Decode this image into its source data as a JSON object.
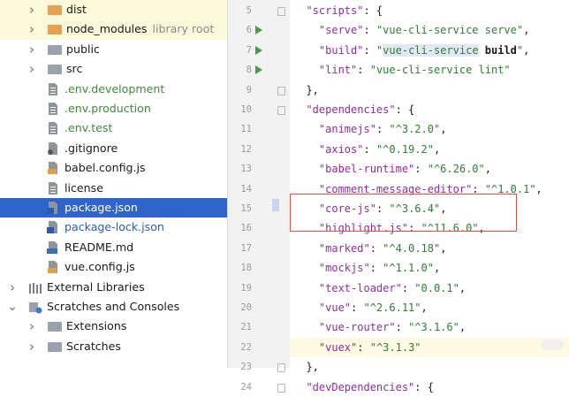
{
  "tree": {
    "items": [
      {
        "label": "dist",
        "hint": "",
        "type": "folder",
        "color": "orange",
        "expander": "collapsed",
        "depth": 1,
        "style": "yellow"
      },
      {
        "label": "node_modules",
        "hint": "library root",
        "type": "folder",
        "color": "orange",
        "expander": "collapsed",
        "depth": 1,
        "style": "yellow"
      },
      {
        "label": "public",
        "hint": "",
        "type": "folder",
        "color": "gray",
        "expander": "collapsed",
        "depth": 1,
        "style": ""
      },
      {
        "label": "src",
        "hint": "",
        "type": "folder",
        "color": "gray",
        "expander": "collapsed",
        "depth": 1,
        "style": ""
      },
      {
        "label": ".env.development",
        "hint": "",
        "type": "file",
        "icon": "text-file-icon",
        "textColor": "green",
        "depth": 2,
        "style": ""
      },
      {
        "label": ".env.production",
        "hint": "",
        "type": "file",
        "icon": "text-file-icon",
        "textColor": "green",
        "depth": 2,
        "style": ""
      },
      {
        "label": ".env.test",
        "hint": "",
        "type": "file",
        "icon": "text-file-icon",
        "textColor": "green",
        "depth": 2,
        "style": ""
      },
      {
        "label": ".gitignore",
        "hint": "",
        "type": "file",
        "icon": "gitignore-file-icon",
        "textColor": "",
        "depth": 2,
        "style": ""
      },
      {
        "label": "babel.config.js",
        "hint": "",
        "type": "file",
        "icon": "js-file-icon",
        "textColor": "",
        "depth": 2,
        "style": ""
      },
      {
        "label": "license",
        "hint": "",
        "type": "file",
        "icon": "text-file-icon",
        "textColor": "",
        "depth": 2,
        "style": ""
      },
      {
        "label": "package.json",
        "hint": "",
        "type": "file",
        "icon": "json-file-icon",
        "textColor": "",
        "depth": 2,
        "style": "selected"
      },
      {
        "label": "package-lock.json",
        "hint": "",
        "type": "file",
        "icon": "json-file-icon",
        "textColor": "blue",
        "depth": 2,
        "style": ""
      },
      {
        "label": "README.md",
        "hint": "",
        "type": "file",
        "icon": "markdown-file-icon",
        "textColor": "",
        "depth": 2,
        "style": ""
      },
      {
        "label": "vue.config.js",
        "hint": "",
        "type": "file",
        "icon": "js-file-icon",
        "textColor": "",
        "depth": 2,
        "style": ""
      },
      {
        "label": "External Libraries",
        "hint": "",
        "type": "libraries",
        "icon": "libraries-icon",
        "expander": "collapsed",
        "depth": 0,
        "style": ""
      },
      {
        "label": "Scratches and Consoles",
        "hint": "",
        "type": "scratches",
        "icon": "scratches-icon",
        "expander": "expanded",
        "depth": 0,
        "style": ""
      },
      {
        "label": "Extensions",
        "hint": "",
        "type": "folder",
        "color": "gray",
        "expander": "collapsed",
        "depth": 1,
        "style": ""
      },
      {
        "label": "Scratches",
        "hint": "",
        "type": "folder",
        "color": "gray",
        "expander": "collapsed",
        "depth": 1,
        "style": ""
      }
    ]
  },
  "gutter": {
    "line_numbers": [
      "5",
      "6",
      "7",
      "8",
      "9",
      "10",
      "11",
      "12",
      "13",
      "14",
      "15",
      "16",
      "17",
      "18",
      "19",
      "20",
      "21",
      "22",
      "23",
      "24"
    ],
    "run_lines": [
      "6",
      "7",
      "8"
    ]
  },
  "editor": {
    "current_line": "22",
    "lines": [
      {
        "n": "5",
        "tokens": [
          {
            "t": "  "
          },
          {
            "t": "\"scripts\"",
            "c": "k"
          },
          {
            "t": ": {"
          }
        ]
      },
      {
        "n": "6",
        "tokens": [
          {
            "t": "    "
          },
          {
            "t": "\"serve\"",
            "c": "k"
          },
          {
            "t": ": "
          },
          {
            "t": "\"vue-cli-service serve\"",
            "c": "s"
          },
          {
            "t": ","
          }
        ]
      },
      {
        "n": "7",
        "tokens": [
          {
            "t": "    "
          },
          {
            "t": "\"build\"",
            "c": "k"
          },
          {
            "t": ": "
          },
          {
            "t": "\"",
            "c": "s"
          },
          {
            "t": "vue-cli-service",
            "c": "s sw"
          },
          {
            "t": " ",
            "c": "s"
          },
          {
            "t": "build",
            "c": "kw"
          },
          {
            "t": "\"",
            "c": "s"
          },
          {
            "t": ","
          }
        ]
      },
      {
        "n": "8",
        "tokens": [
          {
            "t": "    "
          },
          {
            "t": "\"lint\"",
            "c": "k"
          },
          {
            "t": ": "
          },
          {
            "t": "\"vue-cli-service lint\"",
            "c": "s"
          }
        ]
      },
      {
        "n": "9",
        "tokens": [
          {
            "t": "  },"
          }
        ]
      },
      {
        "n": "10",
        "tokens": [
          {
            "t": "  "
          },
          {
            "t": "\"dependencies\"",
            "c": "k"
          },
          {
            "t": ": {"
          }
        ]
      },
      {
        "n": "11",
        "tokens": [
          {
            "t": "    "
          },
          {
            "t": "\"animejs\"",
            "c": "k"
          },
          {
            "t": ": "
          },
          {
            "t": "\"^3.2.0\"",
            "c": "s"
          },
          {
            "t": ","
          }
        ]
      },
      {
        "n": "12",
        "tokens": [
          {
            "t": "    "
          },
          {
            "t": "\"axios\"",
            "c": "k"
          },
          {
            "t": ": "
          },
          {
            "t": "\"^0.19.2\"",
            "c": "s"
          },
          {
            "t": ","
          }
        ]
      },
      {
        "n": "13",
        "tokens": [
          {
            "t": "    "
          },
          {
            "t": "\"babel-runtime\"",
            "c": "k"
          },
          {
            "t": ": "
          },
          {
            "t": "\"^6.26.0\"",
            "c": "s"
          },
          {
            "t": ","
          }
        ]
      },
      {
        "n": "14",
        "tokens": [
          {
            "t": "    "
          },
          {
            "t": "\"comment-message-editor\"",
            "c": "k"
          },
          {
            "t": ": "
          },
          {
            "t": "\"^1.0.1\"",
            "c": "s"
          },
          {
            "t": ","
          }
        ]
      },
      {
        "n": "15",
        "tokens": [
          {
            "t": "    "
          },
          {
            "t": "\"core-js\"",
            "c": "k"
          },
          {
            "t": ": "
          },
          {
            "t": "\"^3.6.4\"",
            "c": "s"
          },
          {
            "t": ","
          }
        ]
      },
      {
        "n": "16",
        "tokens": [
          {
            "t": "    "
          },
          {
            "t": "\"highlight.js\"",
            "c": "k"
          },
          {
            "t": ": "
          },
          {
            "t": "\"^11.6.0\"",
            "c": "s"
          },
          {
            "t": ","
          }
        ]
      },
      {
        "n": "17",
        "tokens": [
          {
            "t": "    "
          },
          {
            "t": "\"marked\"",
            "c": "k"
          },
          {
            "t": ": "
          },
          {
            "t": "\"^4.0.18\"",
            "c": "s"
          },
          {
            "t": ","
          }
        ]
      },
      {
        "n": "18",
        "tokens": [
          {
            "t": "    "
          },
          {
            "t": "\"mockjs\"",
            "c": "k"
          },
          {
            "t": ": "
          },
          {
            "t": "\"^1.1.0\"",
            "c": "s"
          },
          {
            "t": ","
          }
        ]
      },
      {
        "n": "19",
        "tokens": [
          {
            "t": "    "
          },
          {
            "t": "\"text-loader\"",
            "c": "k"
          },
          {
            "t": ": "
          },
          {
            "t": "\"0.0.1\"",
            "c": "s"
          },
          {
            "t": ","
          }
        ]
      },
      {
        "n": "20",
        "tokens": [
          {
            "t": "    "
          },
          {
            "t": "\"vue\"",
            "c": "k"
          },
          {
            "t": ": "
          },
          {
            "t": "\"^2.6.11\"",
            "c": "s"
          },
          {
            "t": ","
          }
        ]
      },
      {
        "n": "21",
        "tokens": [
          {
            "t": "    "
          },
          {
            "t": "\"vue-router\"",
            "c": "k"
          },
          {
            "t": ": "
          },
          {
            "t": "\"^3.1.6\"",
            "c": "s"
          },
          {
            "t": ","
          }
        ]
      },
      {
        "n": "22",
        "tokens": [
          {
            "t": "    "
          },
          {
            "t": "\"vuex\"",
            "c": "k"
          },
          {
            "t": ": "
          },
          {
            "t": "\"^3.1.3\"",
            "c": "s"
          }
        ]
      },
      {
        "n": "23",
        "tokens": [
          {
            "t": "  },"
          }
        ]
      },
      {
        "n": "24",
        "tokens": [
          {
            "t": "  "
          },
          {
            "t": "\"devDependencies\"",
            "c": "k"
          },
          {
            "t": ": {"
          }
        ]
      }
    ]
  },
  "colors": {
    "selection": "#2f65ca",
    "key": "#8e2d9b",
    "string": "#2e7d32",
    "run": "#3f9e47",
    "annotation_box": "#d9534f"
  }
}
